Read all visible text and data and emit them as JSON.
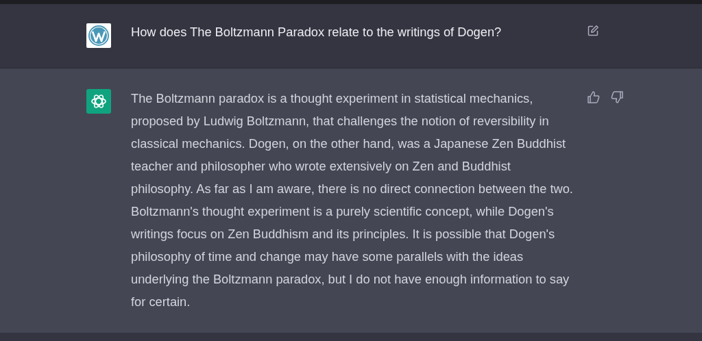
{
  "messages": [
    {
      "kind": "user",
      "text": "How does The Boltzmann Paradox relate to the writings of Dogen?"
    },
    {
      "kind": "assistant",
      "text": "The Boltzmann paradox is a thought experiment in statistical mechanics, proposed by Ludwig Boltzmann, that challenges the notion of reversibility in classical mechanics. Dogen, on the other hand, was a Japanese Zen Buddhist teacher and philosopher who wrote extensively on Zen and Buddhist philosophy. As far as I am aware, there is no direct connection between the two. Boltzmann's thought experiment is a purely scientific concept, while Dogen's writings focus on Zen Buddhism and its principles. It is possible that Dogen's philosophy of time and change may have some parallels with the ideas underlying the Boltzmann paradox, but I do not have enough information to say for certain."
    }
  ]
}
